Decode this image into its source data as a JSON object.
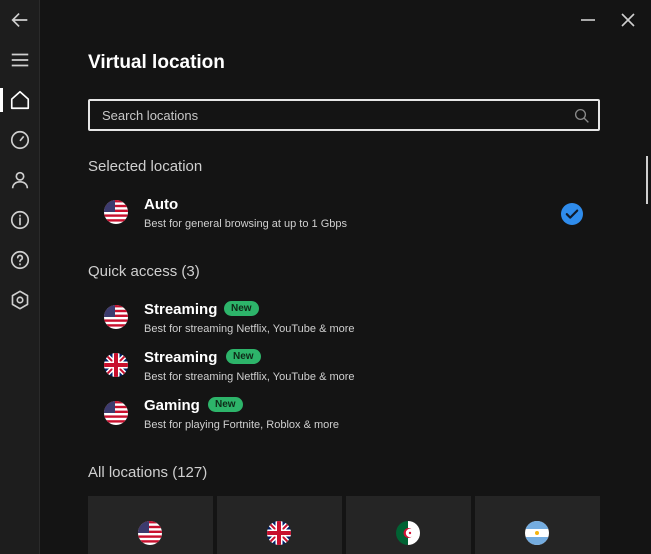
{
  "window": {
    "back_icon": "arrow-left-icon",
    "minimize_icon": "minimize-icon",
    "close_icon": "close-icon"
  },
  "sidebar": {
    "items": [
      {
        "name": "menu",
        "icon": "hamburger-menu-icon"
      },
      {
        "name": "home",
        "icon": "home-icon",
        "active": true
      },
      {
        "name": "speed",
        "icon": "speedometer-icon"
      },
      {
        "name": "account",
        "icon": "user-icon"
      },
      {
        "name": "info",
        "icon": "info-icon"
      },
      {
        "name": "help",
        "icon": "question-icon"
      },
      {
        "name": "settings",
        "icon": "settings-hexagon-icon"
      }
    ]
  },
  "main": {
    "title": "Virtual location",
    "search": {
      "placeholder": "Search locations",
      "value": ""
    },
    "selected_section": {
      "title": "Selected location"
    },
    "selected": {
      "name": "Auto",
      "description": "Best for general browsing at up to 1 Gbps",
      "flag": "us",
      "checked": true
    },
    "quick_access": {
      "title": "Quick access (3)",
      "items": [
        {
          "name": "Streaming",
          "badge": "New",
          "description": "Best for streaming Netflix, YouTube & more",
          "flag": "us"
        },
        {
          "name": "Streaming",
          "badge": "New",
          "description": "Best for streaming Netflix, YouTube & more",
          "flag": "uk"
        },
        {
          "name": "Gaming",
          "badge": "New",
          "description": "Best for playing Fortnite, Roblox & more",
          "flag": "us"
        }
      ]
    },
    "all_locations": {
      "title": "All locations (127)",
      "tiles": [
        {
          "flag": "us"
        },
        {
          "flag": "uk"
        },
        {
          "flag": "algeria"
        },
        {
          "flag": "argentina"
        }
      ]
    }
  },
  "colors": {
    "background": "#141414",
    "sidebar": "#1d1d1d",
    "accent_blue": "#2f8cec",
    "badge_green": "#2db46a",
    "tile": "#252525"
  }
}
